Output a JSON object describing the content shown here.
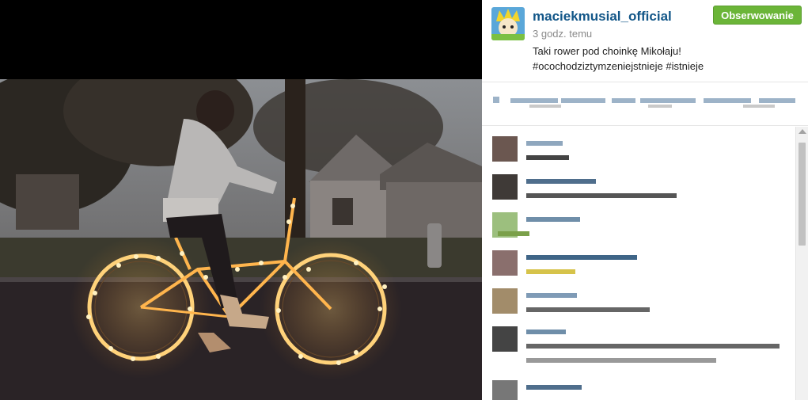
{
  "post": {
    "username": "maciekmusial_official",
    "follow_label": "Obserwowanie",
    "time": "3 godz. temu",
    "caption_line1": "Taki rower pod choinkę Mikołaju!",
    "caption_line2": "#ocochodziztymzeniejstnieje #istnieje"
  },
  "likes": {
    "note": ""
  },
  "colors": {
    "username": "#125688",
    "follow_bg": "#6bb538",
    "bulb": "#ffd27a"
  },
  "comments_count_visible": 7
}
